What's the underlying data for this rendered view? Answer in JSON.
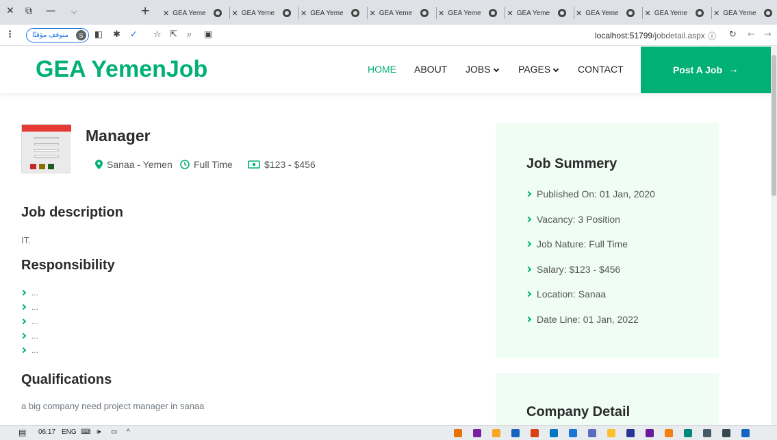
{
  "browser": {
    "tab_title": "GEA Yeme",
    "tab_count": 9,
    "profile_label": "متوقف مؤقتًا",
    "profile_initial": "S",
    "url_host": "localhost:51799",
    "url_path": "/jobdetail.aspx"
  },
  "site": {
    "brand": "GEA YemenJob",
    "nav": {
      "home": "HOME",
      "about": "ABOUT",
      "jobs": "JOBS",
      "pages": "PAGES",
      "contact": "CONTACT"
    },
    "post_job": "Post A Job",
    "accent": "#00b074"
  },
  "job": {
    "title": "Manager",
    "location": "Sanaa - Yemen",
    "type": "Full Time",
    "salary": "$123 - $456"
  },
  "sections": {
    "description_heading": "Job description",
    "description_text": "IT.",
    "responsibility_heading": "Responsibility",
    "responsibilities": [
      "...",
      "...",
      "...",
      "...",
      "..."
    ],
    "qualifications_heading": "Qualifications",
    "qualifications_text": "a big company need project manager in sanaa"
  },
  "summary": {
    "heading": "Job Summery",
    "items": [
      "Published On: 01 Jan, 2020",
      "Vacancy: 3 Position",
      "Job Nature: Full Time",
      "Salary: $123 - $456",
      "Location: Sanaa",
      "Date Line: 01 Jan, 2022"
    ]
  },
  "company": {
    "heading": "Company Detail"
  },
  "taskbar": {
    "time": "06:17",
    "lang": "ENG"
  }
}
